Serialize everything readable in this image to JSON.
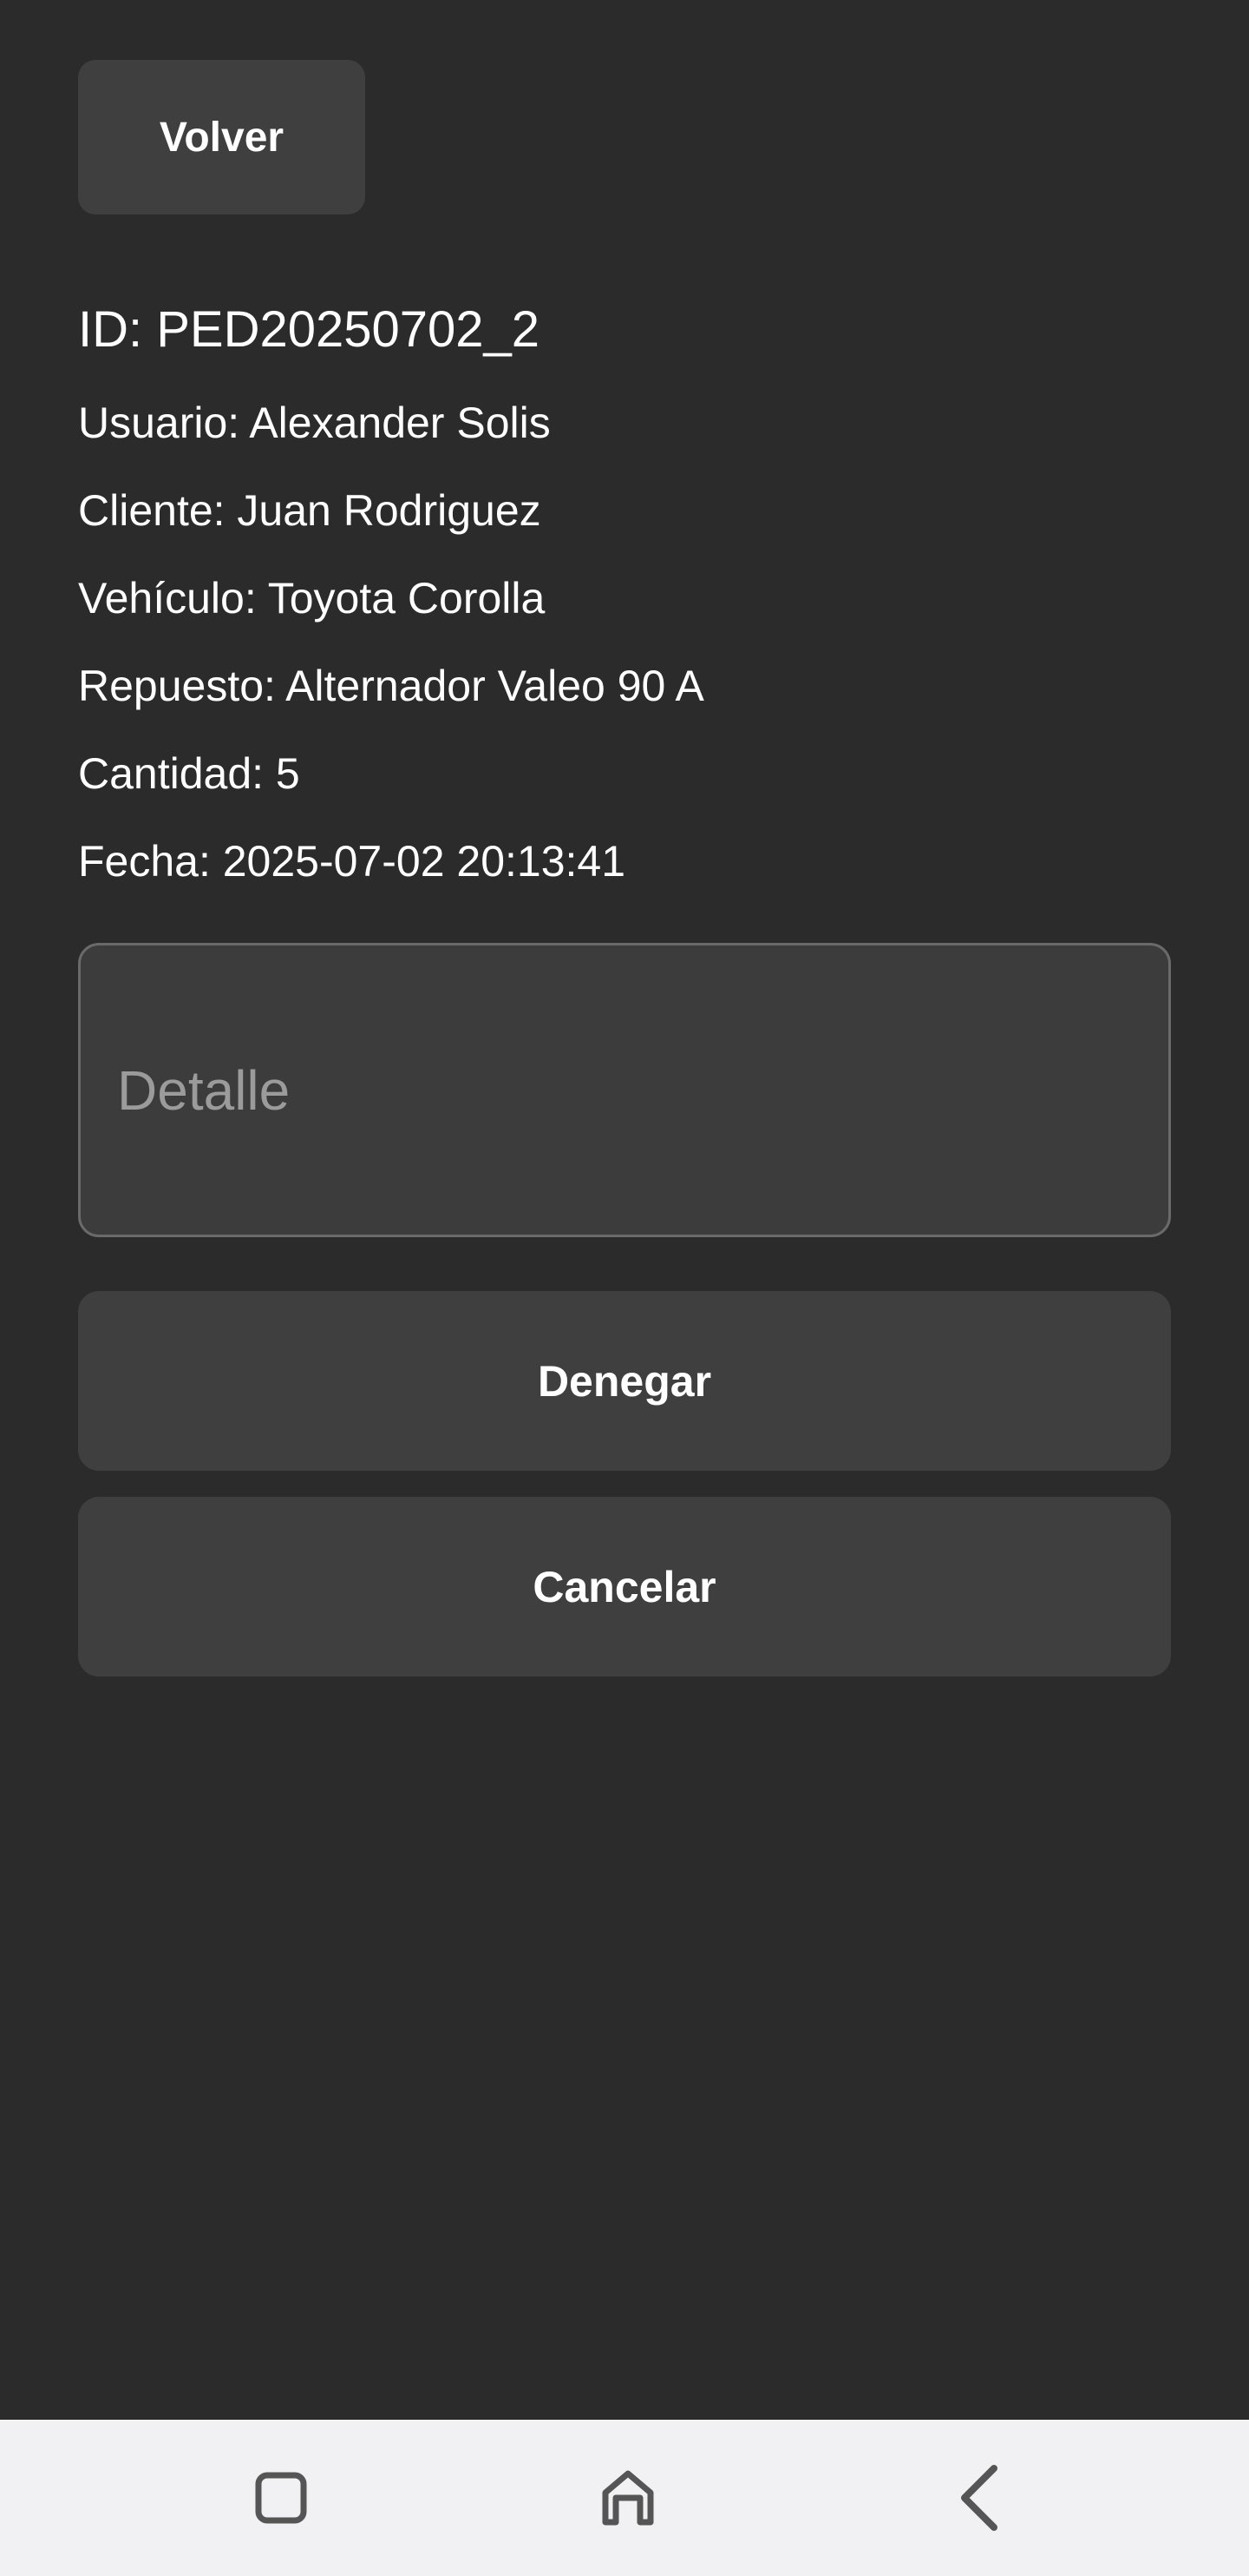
{
  "header": {
    "back_label": "Volver"
  },
  "order": {
    "id": "ID: PED20250702_2",
    "usuario": "Usuario: Alexander Solis",
    "cliente": "Cliente: Juan Rodriguez",
    "vehiculo": "Vehículo: Toyota Corolla",
    "repuesto": "Repuesto: Alternador Valeo 90 A",
    "cantidad": "Cantidad: 5",
    "fecha": "Fecha: 2025-07-02 20:13:41"
  },
  "detail": {
    "placeholder": "Detalle",
    "value": ""
  },
  "actions": {
    "deny_label": "Denegar",
    "cancel_label": "Cancelar"
  },
  "navbar": {
    "recents_icon": "square-icon",
    "home_icon": "home-icon",
    "back_icon": "chevron-left-icon"
  },
  "colors": {
    "background": "#2b2b2b",
    "button": "#3f3f3f",
    "field": "#3c3c3c",
    "navbar": "#f1f1f3",
    "text": "#ffffff"
  }
}
